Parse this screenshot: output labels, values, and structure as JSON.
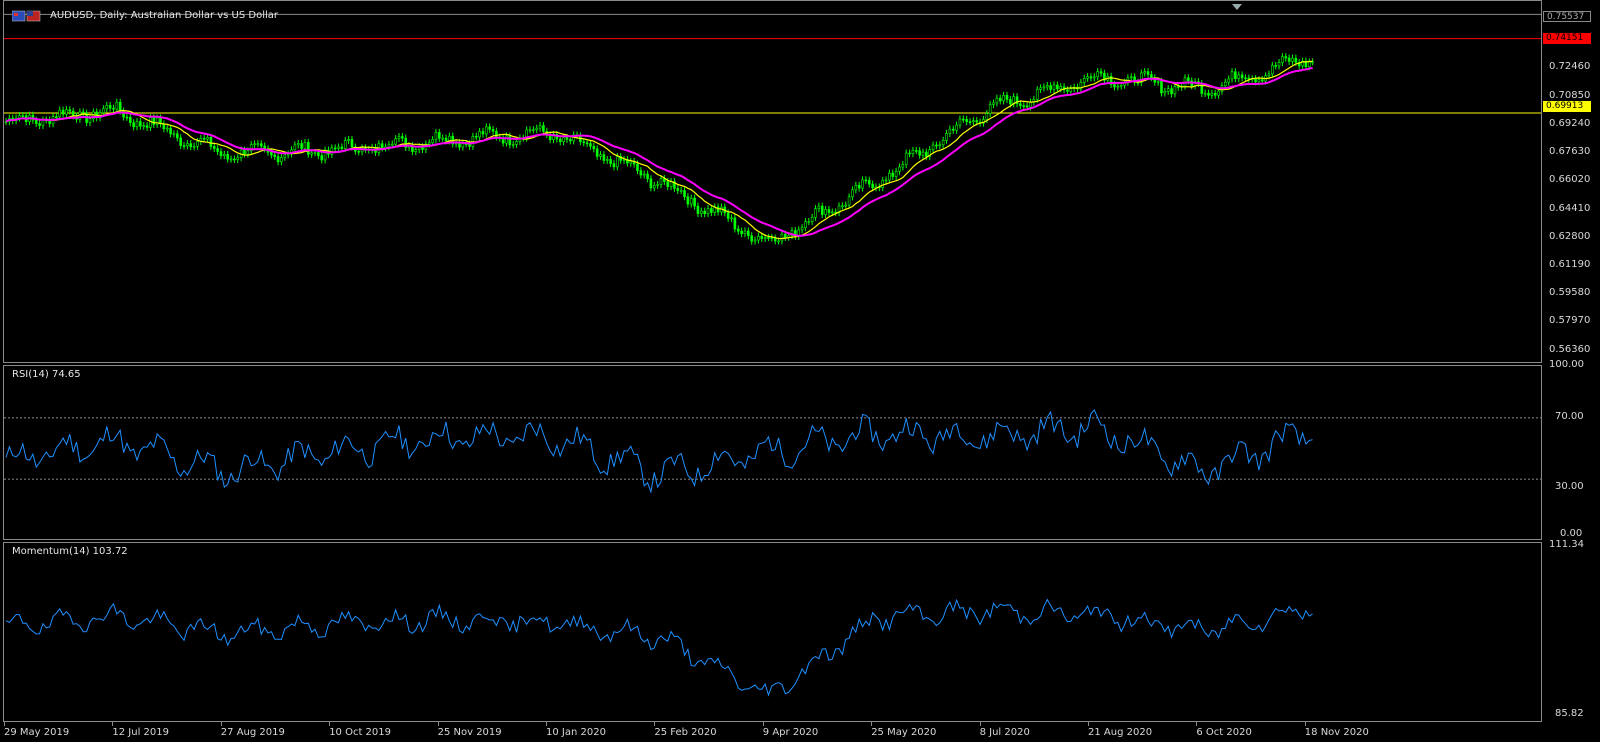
{
  "main": {
    "title": "AUDUSD, Daily:  Australian Dollar vs US Dollar",
    "price_labels": [
      "0.72460",
      "0.70850",
      "0.69240",
      "0.67630",
      "0.66020",
      "0.64410",
      "0.62800",
      "0.61190",
      "0.59580",
      "0.57970",
      "0.56360"
    ],
    "current_price": "0.75537",
    "red_line_price": "0.74151",
    "yellow_line_price": "0.69913",
    "colors": {
      "candle": "#00ff00",
      "ma_fast": "#ffff00",
      "ma_slow": "#ff00ff",
      "red_line": "#ff0000",
      "yellow_line": "#ffff00",
      "current_line": "#8a8a8a"
    }
  },
  "rsi": {
    "label": "RSI(14) 74.65",
    "levels": [
      "100.00",
      "70.00",
      "30.00",
      "0.00"
    ],
    "color": "#1e90ff"
  },
  "momentum": {
    "label": "Momentum(14) 103.72",
    "levels": [
      "111.34",
      "85.82"
    ],
    "color": "#1e90ff"
  },
  "time_axis": [
    "29 May 2019",
    "12 Jul 2019",
    "27 Aug 2019",
    "10 Oct 2019",
    "25 Nov 2019",
    "10 Jan 2020",
    "25 Feb 2020",
    "9 Apr 2020",
    "25 May 2020",
    "8 Jul 2020",
    "21 Aug 2020",
    "6 Oct 2020",
    "18 Nov 2020"
  ],
  "chart_data": [
    {
      "type": "candlestick",
      "series": [
        {
          "values_key": "close",
          "x": [
            "29 May 2019",
            "12 Jul 2019",
            "27 Aug 2019",
            "10 Oct 2019",
            "25 Nov 2019",
            "10 Jan 2020",
            "25 Feb 2020",
            "9 Apr 2020",
            "25 May 2020",
            "8 Jul 2020",
            "21 Aug 2020",
            "6 Oct 2020",
            "18 Nov 2020"
          ],
          "close": [
            0.6943,
            0.7005,
            0.676,
            0.678,
            0.684,
            0.688,
            0.66,
            0.625,
            0.66,
            0.701,
            0.72,
            0.713,
            0.731
          ]
        }
      ],
      "ylim": [
        0.556,
        0.763
      ]
    },
    {
      "type": "line",
      "title": "RSI(14) 74.65",
      "x": [
        "29 May 2019",
        "12 Jul 2019",
        "27 Aug 2019",
        "10 Oct 2019",
        "25 Nov 2019",
        "10 Jan 2020",
        "25 Feb 2020",
        "9 Apr 2020",
        "25 May 2020",
        "8 Jul 2020",
        "21 Aug 2020",
        "6 Oct 2020",
        "18 Nov 2020"
      ],
      "values": [
        42,
        55,
        35,
        48,
        57,
        58,
        33,
        48,
        60,
        58,
        64,
        35,
        62
      ],
      "ylim": [
        0,
        100
      ]
    },
    {
      "type": "line",
      "title": "Momentum(14) 103.72",
      "x": [
        "29 May 2019",
        "12 Jul 2019",
        "27 Aug 2019",
        "10 Oct 2019",
        "25 Nov 2019",
        "10 Jan 2020",
        "25 Feb 2020",
        "9 Apr 2020",
        "25 May 2020",
        "8 Jul 2020",
        "21 Aug 2020",
        "6 Oct 2020",
        "18 Nov 2020"
      ],
      "values": [
        99.0,
        100.8,
        98.0,
        99.5,
        100.2,
        99.8,
        97.5,
        88.5,
        100.5,
        101.5,
        101.0,
        98.5,
        102.0
      ],
      "ylim": [
        85.82,
        111.34
      ]
    }
  ]
}
